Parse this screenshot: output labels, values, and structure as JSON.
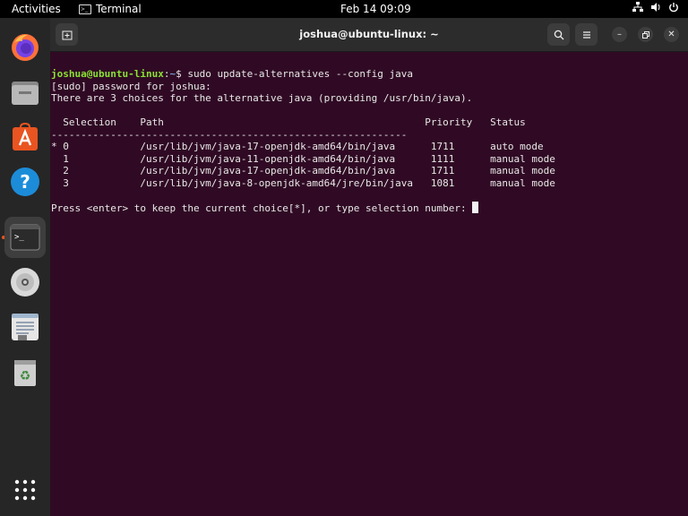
{
  "topbar": {
    "activities": "Activities",
    "app_name": "Terminal",
    "clock": "Feb 14  09:09"
  },
  "dock": {
    "items": [
      "firefox-icon",
      "files-icon",
      "software-icon",
      "help-icon",
      "terminal-icon",
      "disc-icon",
      "text-editor-icon",
      "trash-icon",
      "app-grid-icon"
    ]
  },
  "window": {
    "title": "joshua@ubuntu-linux: ~"
  },
  "terminal": {
    "prompt_user": "joshua@ubuntu-linux",
    "prompt_sep": ":",
    "prompt_path": "~",
    "prompt_dollar": "$ ",
    "command": "sudo update-alternatives --config java",
    "line2": "[sudo] password for joshua:",
    "line3": "There are 3 choices for the alternative java (providing /usr/bin/java).",
    "header": "  Selection    Path                                            Priority   Status",
    "divider": "------------------------------------------------------------",
    "rows": [
      "* 0            /usr/lib/jvm/java-17-openjdk-amd64/bin/java      1711      auto mode",
      "  1            /usr/lib/jvm/java-11-openjdk-amd64/bin/java      1111      manual mode",
      "  2            /usr/lib/jvm/java-17-openjdk-amd64/bin/java      1711      manual mode",
      "  3            /usr/lib/jvm/java-8-openjdk-amd64/jre/bin/java   1081      manual mode"
    ],
    "final_prompt": "Press <enter> to keep the current choice[*], or type selection number: "
  }
}
